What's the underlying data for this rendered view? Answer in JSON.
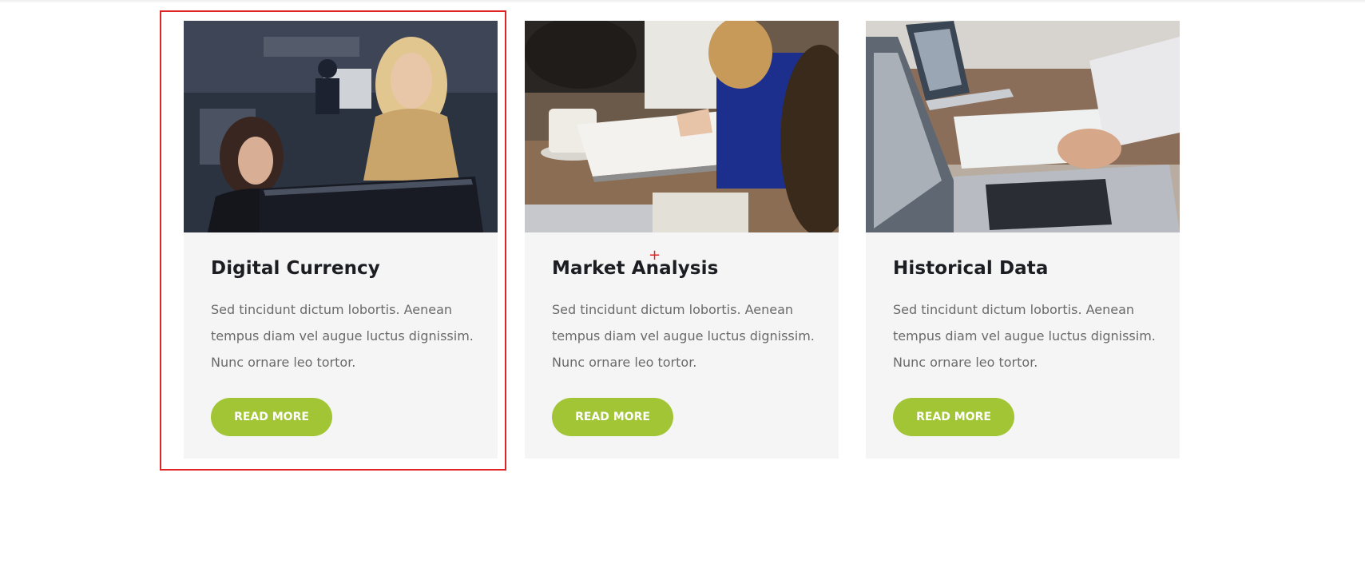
{
  "cards": [
    {
      "title": "Digital Currency",
      "text": "Sed tincidunt dictum lobortis. Aenean tempus diam vel augue luctus dignissim. Nunc ornare leo tortor.",
      "button_label": "READ MORE",
      "image_alt": "two women looking at a computer monitor"
    },
    {
      "title": "Market Analysis",
      "text": "Sed tincidunt dictum lobortis. Aenean tempus diam vel augue luctus dignissim. Nunc ornare leo tortor.",
      "button_label": "READ MORE",
      "image_alt": "people writing notes at a desk with coffee cup"
    },
    {
      "title": "Historical Data",
      "text": "Sed tincidunt dictum lobortis. Aenean tempus diam vel augue luctus dignissim. Nunc ornare leo tortor.",
      "button_label": "READ MORE",
      "image_alt": "laptops and charts on a desk"
    }
  ],
  "colors": {
    "accent": "#a1c535",
    "title": "#1c1d22",
    "body_text": "#6a6a6a",
    "card_bg": "#f5f5f5",
    "selection": "#e02424"
  }
}
